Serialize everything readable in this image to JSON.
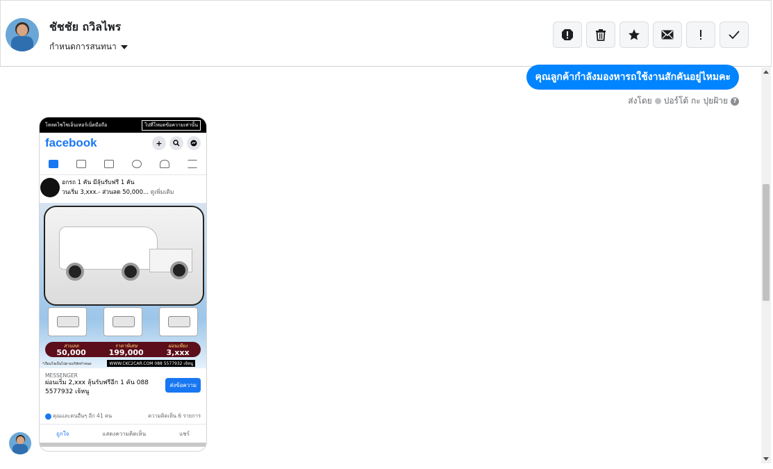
{
  "header": {
    "contact_name": "ชัชชัย ถวิลไพร",
    "assign_label": "กำหนดการสนทนา",
    "actions": [
      "spam-icon",
      "trash-icon",
      "star-icon",
      "envelope-icon",
      "exclamation-icon",
      "check-icon"
    ]
  },
  "message": {
    "text": "คุณลูกค้ากำลังมองหารถใช้งานสักคันอยู่ไหมคะ",
    "sent_by_prefix": "ส่งโดย",
    "sent_by_name": "ปอร์โต้ กะ ปุยฝ้าย"
  },
  "ad": {
    "topbar_text": "โหลดไซโซเอ็นเทอร์เน็ตมือถือ",
    "topbar_button": "ไปที่โหมดข้อความเท่านั้น",
    "brand": "facebook",
    "post_line1": "อกรถ 1 คัน มีลุ้นรับฟรี 1 คัน",
    "post_line2": "วนเริ่ม 3,xxx.- ส่วนลด 50,000...",
    "post_more": "ดูเพิ่มเติม",
    "price_cells": [
      {
        "label": "ส่วนลด",
        "value": "50,000"
      },
      {
        "label": "ราคาพิเศษ",
        "value": "199,000"
      },
      {
        "label": "ผ่อนเพียง",
        "value": "3,xxx"
      }
    ],
    "url_text": "WWW.CKC2CAR.COM 088 5577932 เจ้หนู",
    "left_small": "*เงื่อนไขเป็นไปตามบริษัทกำหนด",
    "cta_label": "MESSENGER",
    "cta_text": "ผ่อนเริ่ม 2,xxx ลุ้นรับฟรีอีก 1 คัน 088 5577932 เจ้หนู",
    "cta_button": "ส่งข้อความ",
    "reactions_left": "คุณและคนอื่นๆ อีก 41 คน",
    "reactions_right": "ความคิดเห็น 6 รายการ",
    "action_like": "ถูกใจ",
    "action_comment": "แสดงความคิดเห็น",
    "action_share": "แชร์"
  },
  "colors": {
    "accent": "#0084ff",
    "fb_blue": "#1877f2"
  }
}
